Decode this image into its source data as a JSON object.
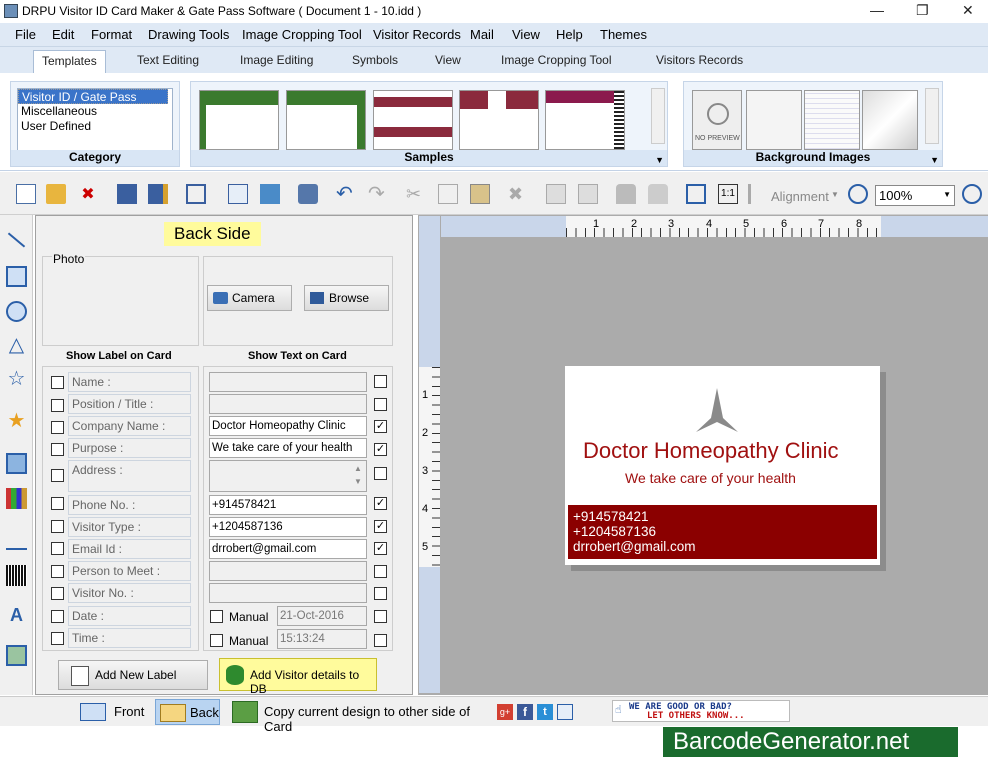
{
  "window": {
    "title": "DRPU Visitor ID Card Maker & Gate Pass Software ( Document 1 - 10.idd )"
  },
  "menu": [
    "File",
    "Edit",
    "Format",
    "Drawing Tools",
    "Image Cropping Tool",
    "Visitor Records",
    "Mail",
    "View",
    "Help",
    "Themes"
  ],
  "tabs": [
    "Templates",
    "Text Editing",
    "Image Editing",
    "Symbols",
    "View",
    "Image Cropping Tool",
    "Visitors Records"
  ],
  "ribbon": {
    "category": {
      "caption": "Category",
      "items": [
        "Visitor ID / Gate Pass",
        "Miscellaneous",
        "User Defined"
      ],
      "selected": 0
    },
    "samples": {
      "caption": "Samples"
    },
    "background": {
      "caption": "Background Images",
      "no_preview": "NO PREVIEW"
    }
  },
  "toolbar": {
    "alignment": "Alignment",
    "zoom": "100%"
  },
  "panel": {
    "side_title": "Back Side",
    "photo_label": "Photo",
    "camera": "Camera",
    "browse": "Browse",
    "show_label_header": "Show Label on Card",
    "show_text_header": "Show Text on Card",
    "rows": [
      {
        "label": "Name :",
        "text": "",
        "text_checked": false
      },
      {
        "label": "Position / Title :",
        "text": "",
        "text_checked": false
      },
      {
        "label": "Company Name :",
        "text": "Doctor Homeopathy Clinic",
        "text_checked": true
      },
      {
        "label": "Purpose :",
        "text": "We take care of your health",
        "text_checked": true
      },
      {
        "label": "Address :",
        "text": "",
        "text_checked": false
      },
      {
        "label": "Phone No. :",
        "text": "+914578421",
        "text_checked": true
      },
      {
        "label": "Visitor Type :",
        "text": "+1204587136",
        "text_checked": true
      },
      {
        "label": "Email Id :",
        "text": "drrobert@gmail.com",
        "text_checked": true
      },
      {
        "label": "Person to Meet :",
        "text": "",
        "text_checked": false
      },
      {
        "label": "Visitor No. :",
        "text": "",
        "text_checked": false
      }
    ],
    "date": {
      "label": "Date :",
      "manual": "Manual",
      "value": "21-Oct-2016"
    },
    "time": {
      "label": "Time :",
      "manual": "Manual",
      "value": "15:13:24"
    },
    "add_label": "Add New Label",
    "add_db": "Add Visitor details to DB"
  },
  "ruler": {
    "top": [
      "1",
      "2",
      "3",
      "4",
      "5",
      "6",
      "7",
      "8"
    ],
    "left": [
      "1",
      "2",
      "3",
      "4",
      "5"
    ]
  },
  "card": {
    "company": "Doctor Homeopathy Clinic",
    "tagline": "We take care of your health",
    "phone": "+914578421",
    "phone2": "+1204587136",
    "email": "drrobert@gmail.com",
    "accent": "#8b0000",
    "text_color": "#a01010"
  },
  "status": {
    "front": "Front",
    "back": "Back",
    "copy": "Copy current design to other side of Card",
    "feedback_line1": "WE ARE GOOD OR BAD?",
    "feedback_line2": "LET OTHERS KNOW..."
  },
  "watermark": "BarcodeGenerator.net"
}
